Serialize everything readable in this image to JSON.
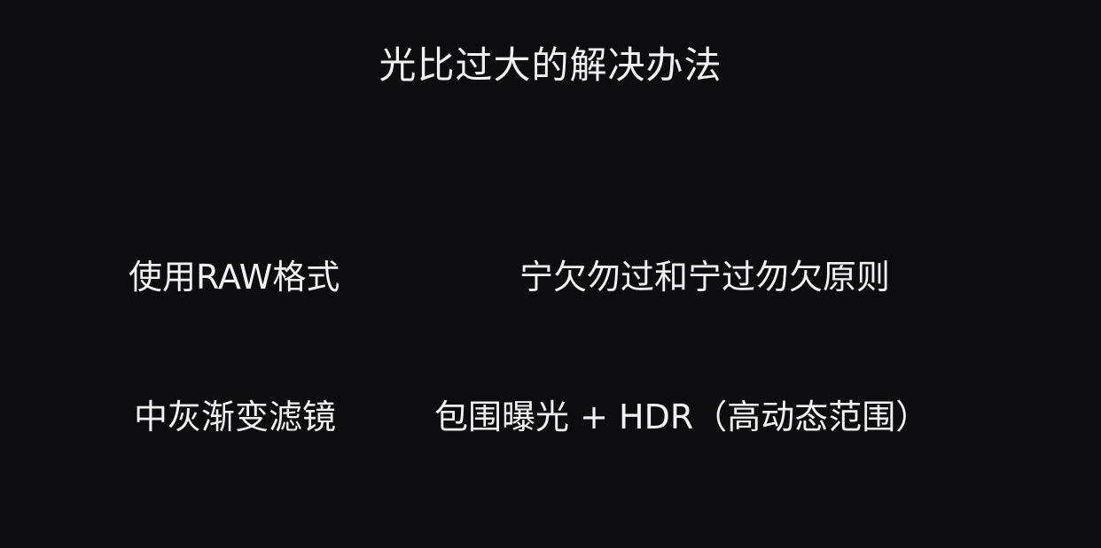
{
  "slide": {
    "title": "光比过大的解决办法",
    "items": [
      "使用RAW格式",
      "宁欠勿过和宁过勿欠原则",
      "中灰渐变滤镜",
      "包围曝光 + HDR（高动态范围）"
    ]
  },
  "colors": {
    "background": "#0d0c0e",
    "text": "#f2f2f2"
  }
}
